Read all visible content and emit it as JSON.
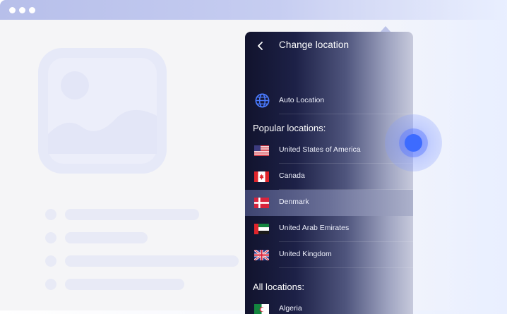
{
  "panel": {
    "title": "Change location",
    "back_icon": "chevron-left-icon",
    "auto_location": {
      "label": "Auto Location",
      "icon": "globe-icon"
    },
    "popular_heading": "Popular locations:",
    "popular": [
      {
        "label": "United States of America",
        "icon": "flag-us-icon"
      },
      {
        "label": "Canada",
        "icon": "flag-ca-icon"
      },
      {
        "label": "Denmark",
        "icon": "flag-dk-icon",
        "selected": true
      },
      {
        "label": "United Arab Emirates",
        "icon": "flag-ae-icon"
      },
      {
        "label": "United Kingdom",
        "icon": "flag-gb-icon"
      }
    ],
    "all_heading": "All locations:",
    "all": [
      {
        "label": "Algeria",
        "icon": "flag-dz-icon"
      }
    ]
  },
  "colors": {
    "accent": "#3d6bff",
    "panel_dark": "#11132d",
    "placeholder": "#e6e9f8"
  }
}
